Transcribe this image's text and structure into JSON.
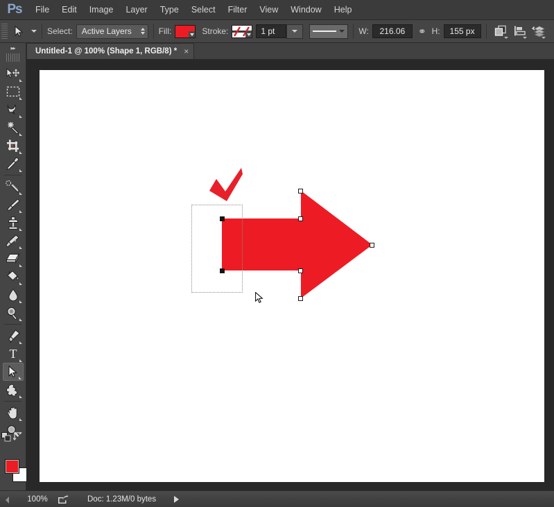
{
  "app": {
    "logo": "Ps",
    "accent_blue": "#8aa9cc",
    "shape_red": "#ec1c24"
  },
  "menubar": {
    "items": [
      {
        "label": "File"
      },
      {
        "label": "Edit"
      },
      {
        "label": "Image"
      },
      {
        "label": "Layer"
      },
      {
        "label": "Type"
      },
      {
        "label": "Select"
      },
      {
        "label": "Filter"
      },
      {
        "label": "View"
      },
      {
        "label": "Window"
      },
      {
        "label": "Help"
      }
    ]
  },
  "options_bar": {
    "tool_preset_icon": "path-selection-arrow-icon",
    "select_label": "Select:",
    "select_value": "Active Layers",
    "fill_label": "Fill:",
    "fill_color": "#ed1c24",
    "stroke_label": "Stroke:",
    "stroke_weight": "1 pt",
    "width_label": "W:",
    "width_value": "216.06",
    "height_label": "H:",
    "height_value": "155 px",
    "link_icon": "chain-link-icon",
    "path_operations_icon": "path-operations-icon",
    "path_alignment_icon": "path-alignment-icon",
    "path_arrangement_icon": "path-arrangement-icon"
  },
  "tab_bar": {
    "document_title": "Untitled-1 @ 100% (Shape 1, RGB/8) *",
    "close_glyph": "×"
  },
  "toolbar": {
    "collapse_glyph": "▸▸",
    "tools": [
      {
        "name": "move-tool",
        "has_flyout": true,
        "selected": false
      },
      {
        "name": "rectangular-marquee-tool",
        "has_flyout": true,
        "selected": false
      },
      {
        "name": "lasso-tool",
        "has_flyout": true,
        "selected": false
      },
      {
        "name": "quick-selection-tool",
        "has_flyout": true,
        "selected": false
      },
      {
        "name": "crop-tool",
        "has_flyout": true,
        "selected": false
      },
      {
        "name": "eyedropper-tool",
        "has_flyout": true,
        "selected": false
      },
      {
        "name": "spot-healing-brush-tool",
        "has_flyout": true,
        "selected": false
      },
      {
        "name": "brush-tool",
        "has_flyout": true,
        "selected": false
      },
      {
        "name": "clone-stamp-tool",
        "has_flyout": true,
        "selected": false
      },
      {
        "name": "history-brush-tool",
        "has_flyout": true,
        "selected": false
      },
      {
        "name": "eraser-tool",
        "has_flyout": true,
        "selected": false
      },
      {
        "name": "gradient-paint-bucket-tool",
        "has_flyout": true,
        "selected": false
      },
      {
        "name": "blur-tool",
        "has_flyout": true,
        "selected": false
      },
      {
        "name": "dodge-tool",
        "has_flyout": true,
        "selected": false
      },
      {
        "name": "pen-tool",
        "has_flyout": true,
        "selected": false
      },
      {
        "name": "type-tool",
        "has_flyout": true,
        "selected": false
      },
      {
        "name": "path-selection-tool",
        "has_flyout": true,
        "selected": true
      },
      {
        "name": "custom-shape-tool",
        "has_flyout": true,
        "selected": false
      },
      {
        "name": "hand-tool",
        "has_flyout": true,
        "selected": false
      },
      {
        "name": "zoom-tool",
        "has_flyout": false,
        "selected": false
      }
    ],
    "foreground_color": "#ec1c24",
    "background_color": "#ffffff",
    "quick_mask_icon": "quick-mask-icon"
  },
  "canvas": {
    "background": "#ffffff",
    "shapes": [
      {
        "name": "checkmark-shape",
        "fill": "#e8202a"
      },
      {
        "name": "right-arrow-shape",
        "fill": "#ed1c24"
      }
    ],
    "selection_rect_style": "dotted",
    "anchor_count": 5,
    "cursor_icon": "arrow-cursor"
  },
  "status_bar": {
    "zoom_level": "100%",
    "share_icon": "share-icon",
    "doc_info": "Doc: 1.23M/0 bytes",
    "expand_glyph": "play-triangle-icon"
  }
}
